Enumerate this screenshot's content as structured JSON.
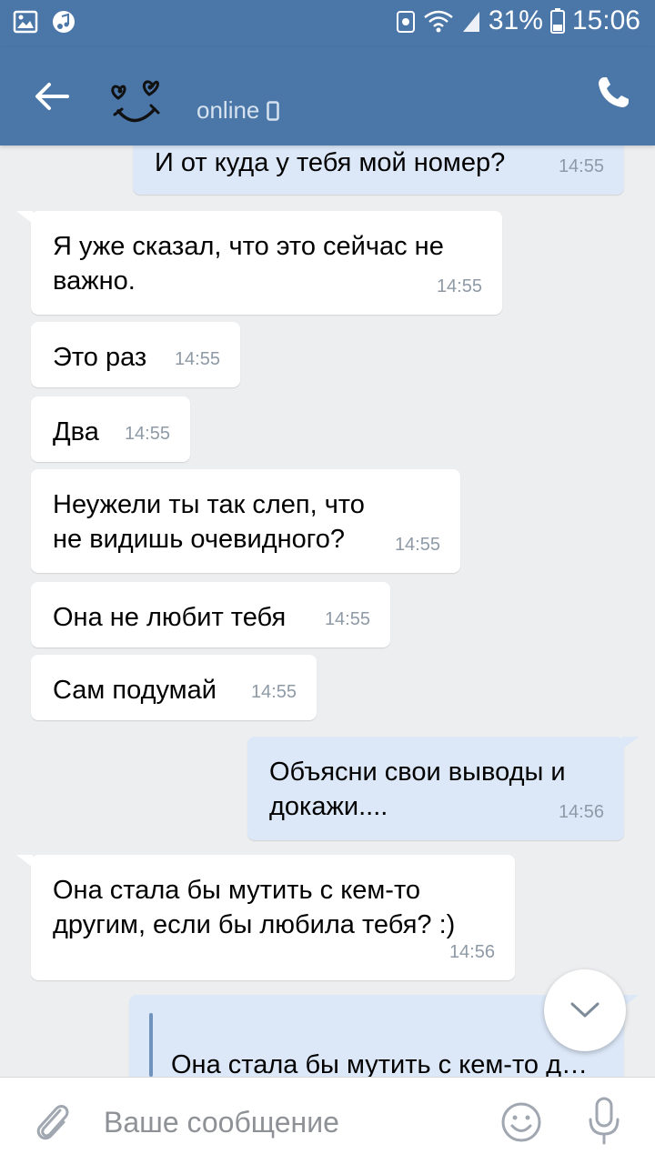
{
  "status_bar": {
    "battery_percent": "31%",
    "time": "15:06"
  },
  "header": {
    "status": "online"
  },
  "messages": [
    {
      "direction": "out",
      "text": "И от куда у тебя мой номер?",
      "time": "14:55"
    },
    {
      "direction": "in",
      "text": "Я уже сказал, что это сейчас не важно.",
      "time": "14:55"
    },
    {
      "direction": "in",
      "text": "Это раз",
      "time": "14:55"
    },
    {
      "direction": "in",
      "text": "Два",
      "time": "14:55"
    },
    {
      "direction": "in",
      "text": "Неужели ты так слеп, что не видишь очевидного?",
      "time": "14:55"
    },
    {
      "direction": "in",
      "text": "Она не любит тебя",
      "time": "14:55"
    },
    {
      "direction": "in",
      "text": "Сам подумай",
      "time": "14:55"
    },
    {
      "direction": "out",
      "text": "Объясни свои выводы и докажи....",
      "time": "14:56"
    },
    {
      "direction": "in",
      "text": "Она стала бы мутить с кем-то другим, если бы любила тебя? :)",
      "time": "14:56"
    },
    {
      "direction": "out",
      "quote": "Она стала бы мутить с кем-то д…"
    }
  ],
  "composer": {
    "placeholder": "Ваше сообщение"
  },
  "icons": {
    "back": "arrow-left-icon",
    "phone": "phone-icon",
    "attach": "paperclip-icon",
    "emoji": "smiley-icon",
    "mic": "microphone-icon",
    "scroll_down": "chevron-down-icon"
  },
  "colors": {
    "header": "#4a76a8",
    "background": "#edeef0",
    "incoming_bubble": "#ffffff",
    "outgoing_bubble": "#dce8f8",
    "time": "#8e9aa6"
  }
}
